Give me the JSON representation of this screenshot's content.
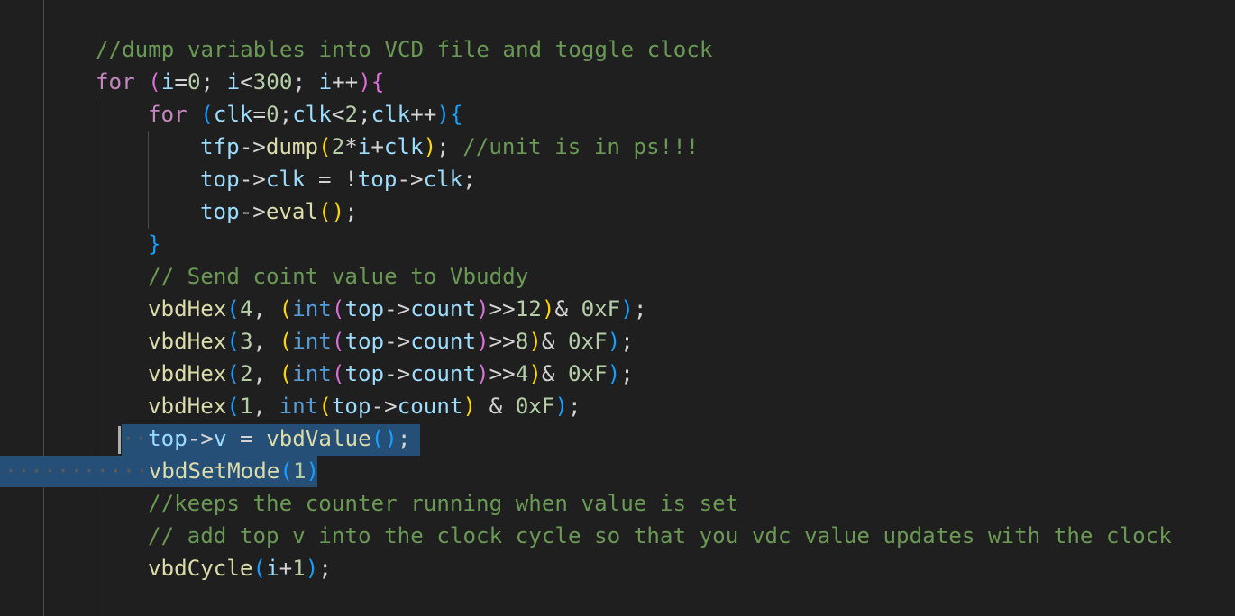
{
  "editor": {
    "language": "cpp",
    "theme_colors": {
      "background": "#1f1f1f",
      "selection": "#264f78",
      "keyword": "#c586c0",
      "type": "#569cd6",
      "variable": "#9cdcfe",
      "function": "#dcdcaa",
      "number": "#b5cea8",
      "comment": "#6a9955"
    },
    "lines": [
      "//dump variables into VCD file and toggle clock",
      "for (i=0; i<300; i++){",
      "for (clk=0;clk<2;clk++){",
      "tfp->dump(2*i+clk); //unit is in ps!!!",
      "top->clk = !top->clk;",
      "top->eval();",
      "}",
      "// Send coint value to Vbuddy",
      "vbdHex(4, (int(top->count)>>12)& 0xF);",
      "vbdHex(3, (int(top->count)>>8)& 0xF);",
      "vbdHex(2, (int(top->count)>>4)& 0xF);",
      "vbdHex(1, int(top->count) & 0xF);",
      "top->v = vbdValue();",
      "vbdSetMode(1)",
      "//keeps the counter running when value is set",
      "// add top v into the clock cycle so that you vdc value updates with the clock",
      "vbdCycle(i+1);"
    ],
    "tokens": {
      "l0": [
        "//dump variables into VCD file and toggle clock"
      ],
      "l1": [
        "for",
        " ",
        "(",
        "i",
        "=",
        "0",
        "; ",
        "i",
        "<",
        "300",
        "; ",
        "i",
        "++",
        ")",
        "{"
      ],
      "l2": [
        "for",
        " ",
        "(",
        "clk",
        "=",
        "0",
        ";",
        "clk",
        "<",
        "2",
        ";",
        "clk",
        "++",
        ")",
        "{"
      ],
      "l3": [
        "tfp",
        "->",
        "dump",
        "(",
        "2",
        "*",
        "i",
        "+",
        "clk",
        ")",
        "; ",
        "//unit is in ps!!!"
      ],
      "l4": [
        "top",
        "->",
        "clk",
        " = !",
        "top",
        "->",
        "clk",
        ";"
      ],
      "l5": [
        "top",
        "->",
        "eval",
        "(",
        ")",
        ";"
      ],
      "l6": [
        "}"
      ],
      "l7": [
        "// Send coint value to Vbuddy"
      ],
      "l8": [
        "vbdHex",
        "(",
        "4",
        ", ",
        "(",
        "int",
        "(",
        "top",
        "->",
        "count",
        ")",
        ">>",
        "12",
        ")",
        "& ",
        "0xF",
        ")",
        ";"
      ],
      "l9": [
        "vbdHex",
        "(",
        "3",
        ", ",
        "(",
        "int",
        "(",
        "top",
        "->",
        "count",
        ")",
        ">>",
        "8",
        ")",
        "& ",
        "0xF",
        ")",
        ";"
      ],
      "l10": [
        "vbdHex",
        "(",
        "2",
        ", ",
        "(",
        "int",
        "(",
        "top",
        "->",
        "count",
        ")",
        ">>",
        "4",
        ")",
        "& ",
        "0xF",
        ")",
        ";"
      ],
      "l11": [
        "vbdHex",
        "(",
        "1",
        ", ",
        "int",
        "(",
        "top",
        "->",
        "count",
        ")",
        " & ",
        "0xF",
        ")",
        ";"
      ],
      "l12": [
        "top",
        "->",
        "v",
        " = ",
        "vbdValue",
        "(",
        ")",
        ";"
      ],
      "l13": [
        "vbdSetMode",
        "(",
        "1",
        ")"
      ],
      "l14": [
        "//keeps the counter running when value is set"
      ],
      "l15": [
        "// add top v into the clock cycle so that you vdc value updates with the clock"
      ],
      "l16": [
        "vbdCycle",
        "(",
        "i",
        "+",
        "1",
        ")",
        ";"
      ]
    },
    "whitespace_markers": {
      "l12": "··",
      "l13": "············"
    }
  }
}
